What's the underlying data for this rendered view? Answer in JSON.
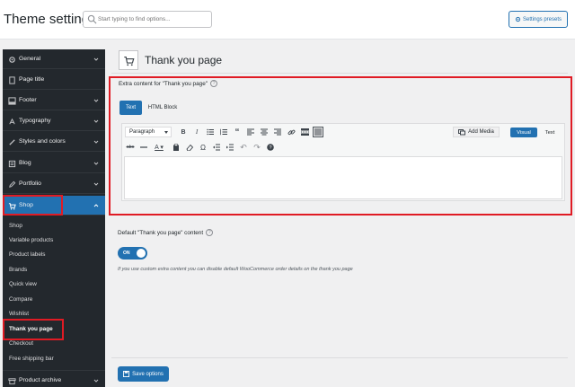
{
  "header": {
    "title": "Theme settings",
    "search_placeholder": "Start typing to find options...",
    "presets_label": "Settings presets"
  },
  "sidebar": {
    "items": [
      {
        "label": "General",
        "icon": "gear-icon",
        "expandable": true
      },
      {
        "label": "Page title",
        "icon": "page-icon",
        "expandable": false
      },
      {
        "label": "Footer",
        "icon": "footer-icon",
        "expandable": true
      },
      {
        "label": "Typography",
        "icon": "type-icon",
        "expandable": true
      },
      {
        "label": "Styles and colors",
        "icon": "brush-icon",
        "expandable": true
      },
      {
        "label": "Blog",
        "icon": "blog-icon",
        "expandable": true
      },
      {
        "label": "Portfolio",
        "icon": "pencil-icon",
        "expandable": true
      },
      {
        "label": "Shop",
        "icon": "cart-icon",
        "expandable": true,
        "active": true
      }
    ],
    "sub_items": [
      "Shop",
      "Variable products",
      "Product labels",
      "Brands",
      "Quick view",
      "Compare",
      "Wishlist",
      "Thank you page",
      "Checkout",
      "Free shipping bar"
    ],
    "current_sub": "Thank you page",
    "bottom_item": {
      "label": "Product archive",
      "icon": "archive-icon"
    }
  },
  "main": {
    "section_title": "Thank you page",
    "extra_label": "Extra content for \"Thank you page\"",
    "tabs": [
      "Text",
      "HTML Block"
    ],
    "editor": {
      "format_value": "Paragraph",
      "add_media": "Add Media",
      "mode_visual": "Visual",
      "mode_text": "Text"
    },
    "default_label": "Default \"Thank you page\" content",
    "toggle_label": "ON",
    "hint": "If you use custom extra content you can disable default WooCommerce order details on the thank you page",
    "save_label": "Save options"
  },
  "colors": {
    "accent": "#2271b1",
    "sidebar_bg": "#23282d",
    "highlight": "#e01b24"
  }
}
